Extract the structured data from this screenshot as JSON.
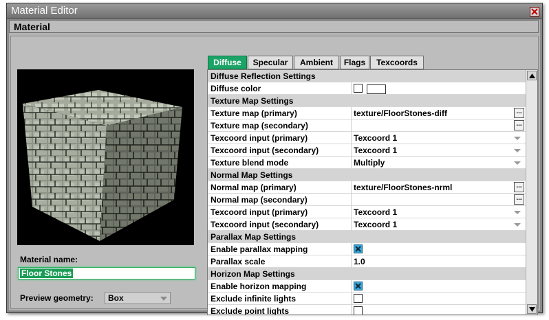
{
  "window": {
    "title": "Material Editor",
    "close_icon": "close-icon"
  },
  "section": {
    "title": "Material"
  },
  "left": {
    "material_name_label": "Material name:",
    "material_name_value": "Floor Stones",
    "preview_geometry_label": "Preview geometry:",
    "preview_geometry_value": "Box"
  },
  "tabs": [
    {
      "label": "Diffuse",
      "active": true
    },
    {
      "label": "Specular",
      "active": false
    },
    {
      "label": "Ambient",
      "active": false
    },
    {
      "label": "Flags",
      "active": false
    },
    {
      "label": "Texcoords",
      "active": false
    }
  ],
  "props": {
    "h_diffuse": "Diffuse Reflection Settings",
    "diffuse_color": "Diffuse color",
    "h_texture": "Texture Map Settings",
    "tex_primary": "Texture map (primary)",
    "tex_primary_val": "texture/FloorStones-diff",
    "tex_secondary": "Texture map (secondary)",
    "tc_in_primary": "Texcoord input (primary)",
    "tc_in_primary_val": "Texcoord 1",
    "tc_in_secondary": "Texcoord input (secondary)",
    "tc_in_secondary_val": "Texcoord 1",
    "blend_mode": "Texture blend mode",
    "blend_mode_val": "Multiply",
    "h_normal": "Normal Map Settings",
    "normal_primary": "Normal map (primary)",
    "normal_primary_val": "texture/FloorStones-nrml",
    "normal_secondary": "Normal map (secondary)",
    "n_tc_primary": "Texcoord input (primary)",
    "n_tc_primary_val": "Texcoord 1",
    "n_tc_secondary": "Texcoord input (secondary)",
    "n_tc_secondary_val": "Texcoord 1",
    "h_parallax": "Parallax Map Settings",
    "enable_parallax": "Enable parallax mapping",
    "parallax_scale": "Parallax scale",
    "parallax_scale_val": "1.0",
    "h_horizon": "Horizon Map Settings",
    "enable_horizon": "Enable horizon mapping",
    "exclude_infinite": "Exclude infinite lights",
    "exclude_point": "Exclude point lights",
    "browse_label": "...",
    "enable_parallax_checked": true,
    "enable_horizon_checked": true,
    "exclude_infinite_checked": false,
    "exclude_point_checked": false,
    "diffuse_color_checked": false
  },
  "colors": {
    "accent": "#1aa466",
    "checkbox_on": "#3aa6d8"
  }
}
